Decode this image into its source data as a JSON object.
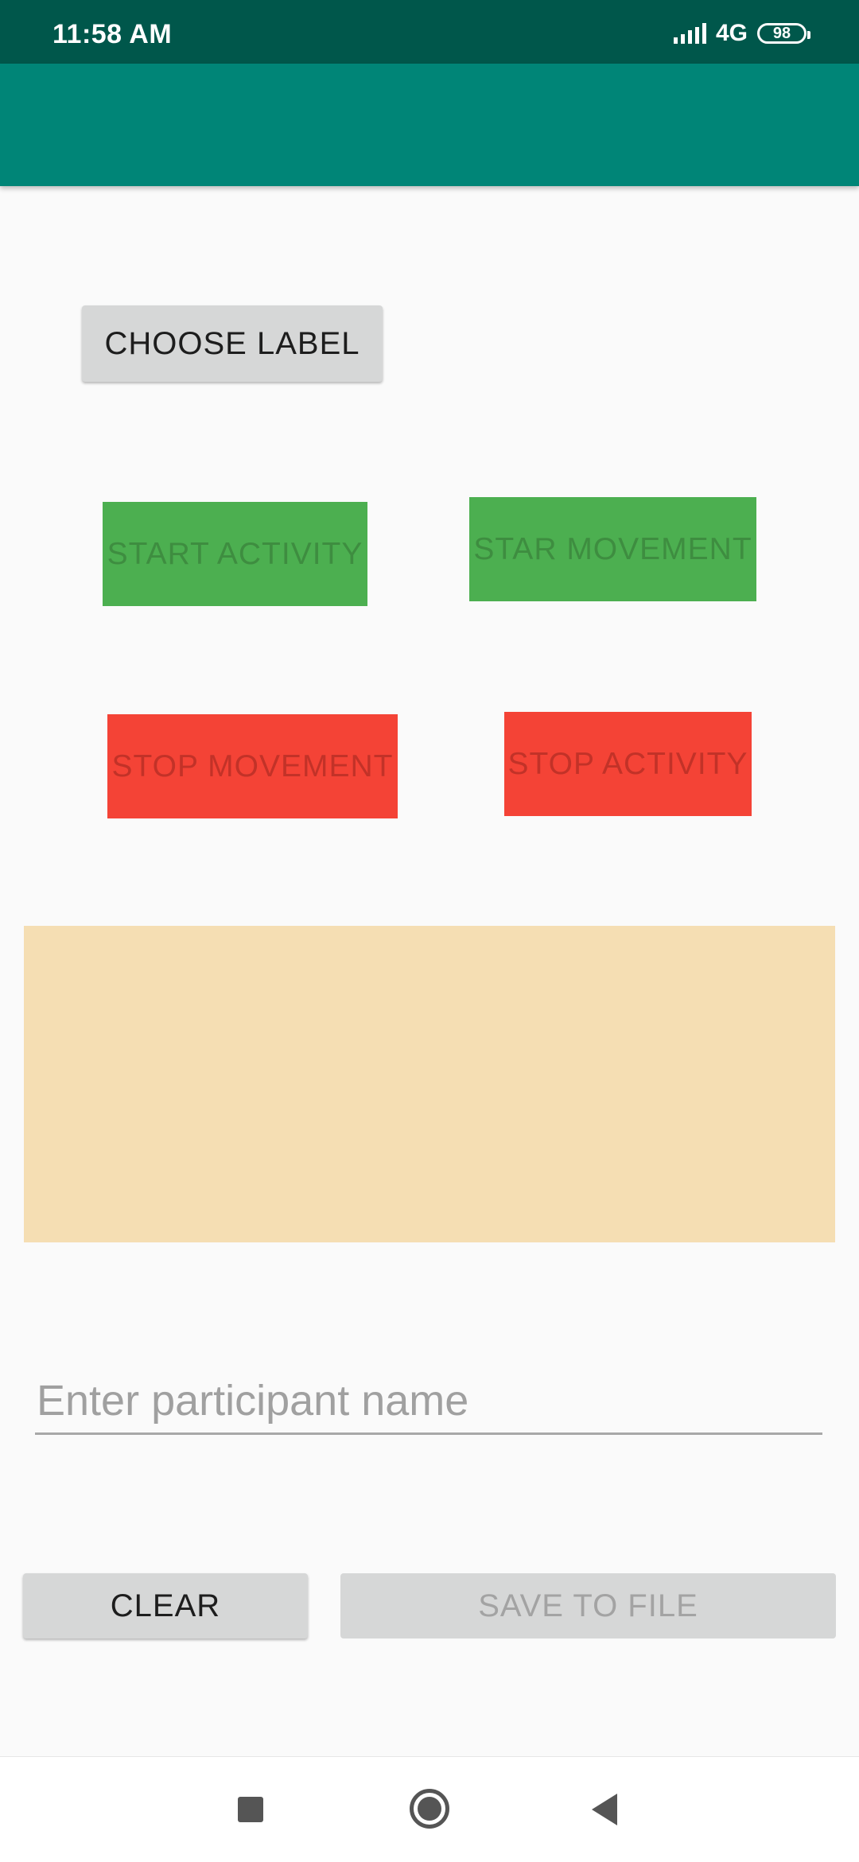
{
  "status_bar": {
    "time": "11:58 AM",
    "network": "4G",
    "battery": "98"
  },
  "buttons": {
    "choose_label": "CHOOSE LABEL",
    "start_activity": "START ACTIVITY",
    "star_movement": "STAR MOVEMENT",
    "stop_movement": "STOP MOVEMENT",
    "stop_activity": "STOP ACTIVITY",
    "clear": "CLEAR",
    "save_to_file": "SAVE TO FILE"
  },
  "participant_input": {
    "value": "",
    "placeholder": "Enter participant name"
  },
  "colors": {
    "status_bar": "#00574b",
    "app_bar": "#008577",
    "start_green": "#4caf50",
    "stop_red": "#f44336",
    "log_panel": "#f5deb3"
  },
  "icons": {
    "signal": "signal-icon",
    "battery": "battery-icon",
    "nav_recent": "square-icon",
    "nav_home": "circle-icon",
    "nav_back": "triangle-back-icon"
  }
}
